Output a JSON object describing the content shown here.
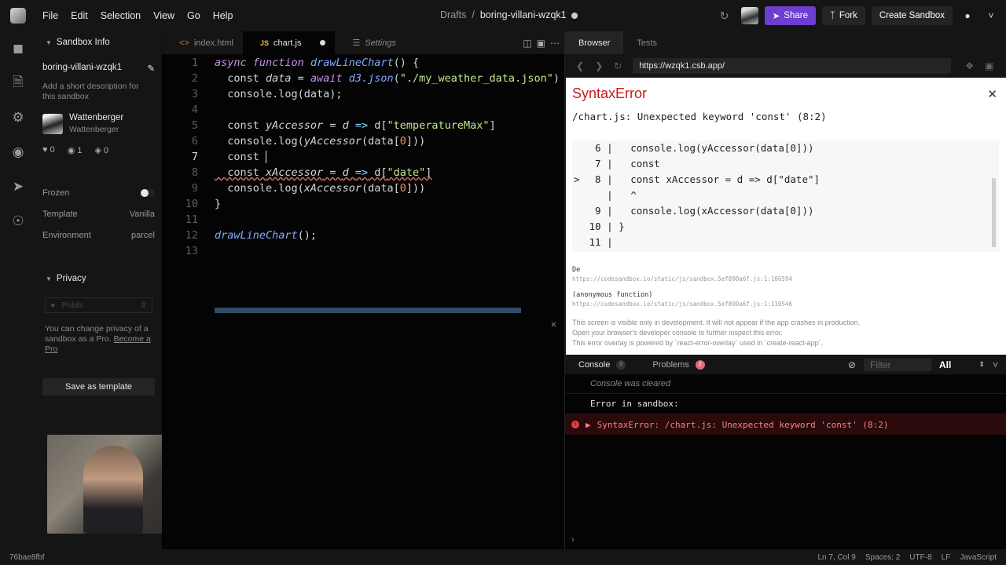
{
  "menu": [
    "File",
    "Edit",
    "Selection",
    "View",
    "Go",
    "Help"
  ],
  "breadcrumb": {
    "folder": "Drafts",
    "separator": "/",
    "sandbox": "boring-villani-wzqk1"
  },
  "topbar": {
    "share": "Share",
    "fork": "Fork",
    "create": "Create Sandbox"
  },
  "sidebar": {
    "section_title": "Sandbox Info",
    "sandbox_name": "boring-villani-wzqk1",
    "description_placeholder": "Add a short description for this sandbox",
    "author_name": "Wattenberger",
    "author_handle": "Wattenberger",
    "likes": "0",
    "views": "1",
    "forks": "0",
    "frozen_label": "Frozen",
    "template_label": "Template",
    "template_value": "Vanilla",
    "environment_label": "Environment",
    "environment_value": "parcel",
    "privacy_title": "Privacy",
    "privacy_value": "Public",
    "privacy_note": "You can change privacy of a sandbox as a Pro.",
    "privacy_link": "Become a Pro",
    "save_template": "Save as template"
  },
  "editor": {
    "tabs": [
      {
        "label": "index.html"
      },
      {
        "label": "chart.js",
        "badge": "JS"
      },
      {
        "label": "Settings"
      }
    ],
    "lines": [
      "1",
      "2",
      "3",
      "4",
      "5",
      "6",
      "7",
      "8",
      "9",
      "10",
      "11",
      "12",
      "13"
    ]
  },
  "browser": {
    "tabs": [
      "Browser",
      "Tests"
    ],
    "url": "https://wzqk1.csb.app/",
    "error_title": "SyntaxError",
    "error_message": "/chart.js: Unexpected keyword 'const' (8:2)",
    "stack_1_name": "De",
    "stack_1_url": "https://codesandbox.io/static/js/sandbox.5ef890a6f.js:1:106594",
    "stack_2_name": "(anonymous function)",
    "stack_2_url": "https://codesandbox.io/static/js/sandbox.5ef890a6f.js:1:110546",
    "footer_1": "This screen is visible only in development. It will not appear if the app crashes in production.",
    "footer_2": "Open your browser's developer console to further inspect this error.",
    "footer_3": "This error overlay is powered by `react-error-overlay` used in `create-react-app`."
  },
  "console": {
    "tab_console": "Console",
    "console_count": "0",
    "tab_problems": "Problems",
    "problems_count": "2",
    "filter_placeholder": "Filter",
    "level": "All",
    "line_cleared": "Console was cleared",
    "line_error_in": "Error in sandbox:",
    "line_error": "SyntaxError: /chart.js: Unexpected keyword 'const' (8:2)"
  },
  "status": {
    "hash": "76bae8fbf",
    "position": "Ln 7, Col 9",
    "spaces": "Spaces: 2",
    "encoding": "UTF-8",
    "eol": "LF",
    "language": "JavaScript"
  },
  "colors": {
    "accent": "#6c3fd0",
    "error": "#c61b1b",
    "keyword": "#c792ea",
    "string": "#c3e88d"
  }
}
